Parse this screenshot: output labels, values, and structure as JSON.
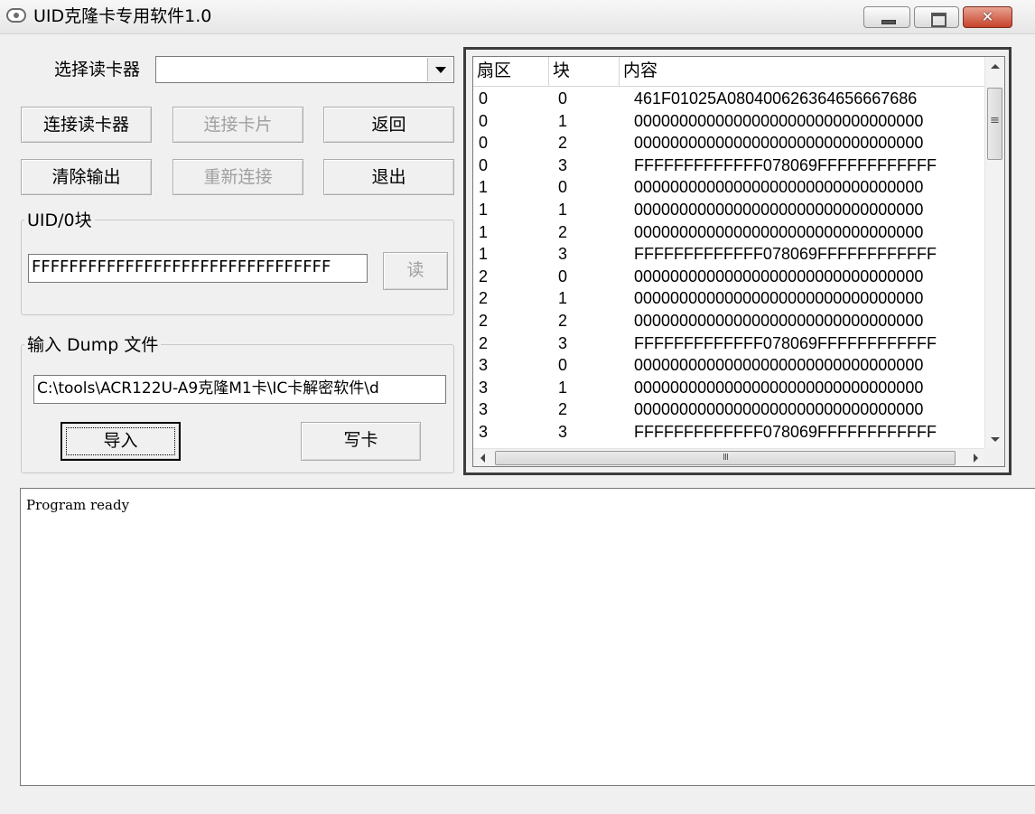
{
  "window": {
    "title": "UID克隆卡专用软件1.0"
  },
  "reader": {
    "label": "选择读卡器",
    "selected": ""
  },
  "buttons": {
    "connect_reader": "连接读卡器",
    "connect_card": "连接卡片",
    "back": "返回",
    "clear_output": "清除输出",
    "reconnect": "重新连接",
    "exit": "退出",
    "read": "读",
    "import": "导入",
    "write_card": "写卡"
  },
  "uid_group": {
    "title": "UID/0块",
    "value": "FFFFFFFFFFFFFFFFFFFFFFFFFFFFFFFF"
  },
  "dump_group": {
    "title": "输入 Dump 文件",
    "path": "C:\\tools\\ACR122U-A9克隆M1卡\\IC卡解密软件\\d"
  },
  "table": {
    "columns": [
      "扇区",
      "块",
      "内容"
    ],
    "rows": [
      [
        "0",
        "0",
        "461F01025A080400626364656667686"
      ],
      [
        "0",
        "1",
        "00000000000000000000000000000000"
      ],
      [
        "0",
        "2",
        "00000000000000000000000000000000"
      ],
      [
        "0",
        "3",
        "FFFFFFFFFFFFF078069FFFFFFFFFFFF"
      ],
      [
        "1",
        "0",
        "00000000000000000000000000000000"
      ],
      [
        "1",
        "1",
        "00000000000000000000000000000000"
      ],
      [
        "1",
        "2",
        "00000000000000000000000000000000"
      ],
      [
        "1",
        "3",
        "FFFFFFFFFFFFF078069FFFFFFFFFFFF"
      ],
      [
        "2",
        "0",
        "00000000000000000000000000000000"
      ],
      [
        "2",
        "1",
        "00000000000000000000000000000000"
      ],
      [
        "2",
        "2",
        "00000000000000000000000000000000"
      ],
      [
        "2",
        "3",
        "FFFFFFFFFFFFF078069FFFFFFFFFFFF"
      ],
      [
        "3",
        "0",
        "00000000000000000000000000000000"
      ],
      [
        "3",
        "1",
        "00000000000000000000000000000000"
      ],
      [
        "3",
        "2",
        "00000000000000000000000000000000"
      ],
      [
        "3",
        "3",
        "FFFFFFFFFFFFF078069FFFFFFFFFFFF"
      ]
    ]
  },
  "output": {
    "text": "Program ready"
  },
  "icons": {
    "app": "app-icon",
    "minimize": "minimize-icon",
    "maximize": "maximize-icon",
    "close": "close-icon",
    "dropdown": "chevron-down-icon"
  }
}
